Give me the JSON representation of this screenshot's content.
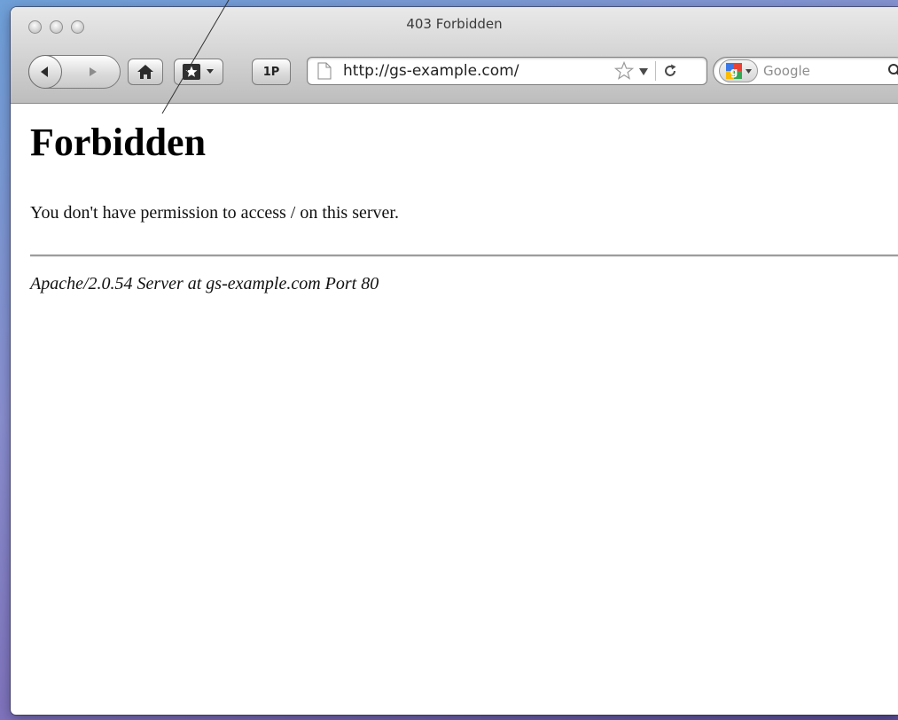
{
  "window": {
    "title": "403 Forbidden"
  },
  "toolbar": {
    "back_icon": "back-arrow-icon",
    "forward_icon": "forward-arrow-icon",
    "home_icon": "home-icon",
    "bookmarks_icon": "bookmark-star-icon",
    "onepassword_label": "1P"
  },
  "address_bar": {
    "url": "http://gs-example.com/",
    "page_icon": "page-icon",
    "star_icon": "bookmark-star-outline-icon",
    "dropdown_icon": "dropdown-triangle-icon",
    "reload_icon": "reload-icon"
  },
  "search_bar": {
    "engine_icon": "google-icon",
    "placeholder": "Google",
    "search_icon": "magnifier-icon"
  },
  "page": {
    "heading": "Forbidden",
    "message": "You don't have permission to access / on this server.",
    "server_signature": "Apache/2.0.54 Server at gs-example.com Port 80"
  },
  "colors": {
    "desktop_gradient": [
      "#6fa0d8",
      "#7d6db8"
    ],
    "chrome_gray": "#d6d6d6",
    "page_bg": "#ffffff"
  }
}
